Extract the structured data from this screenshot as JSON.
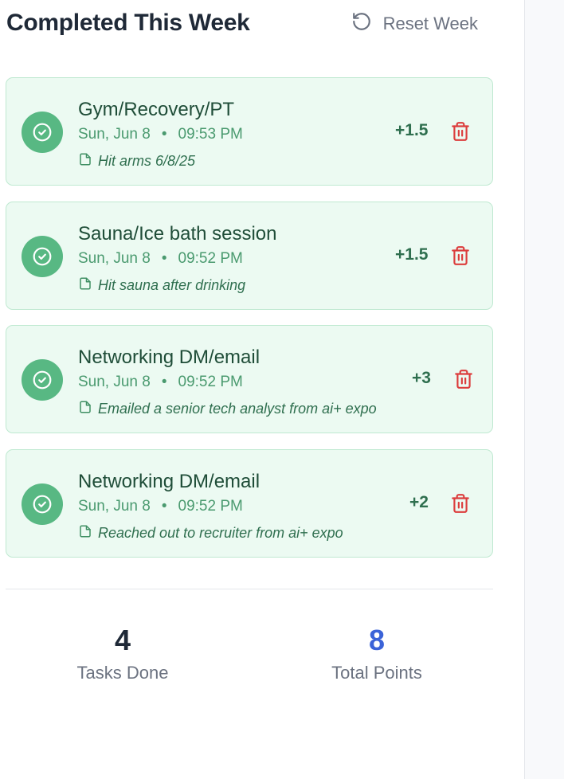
{
  "header": {
    "title": "Completed This Week",
    "reset_label": "Reset Week"
  },
  "tasks": [
    {
      "name": "Gym/Recovery/PT",
      "date": "Sun, Jun 8",
      "separator": "•",
      "time": "09:53 PM",
      "note": "Hit arms 6/8/25",
      "points": "+1.5"
    },
    {
      "name": "Sauna/Ice bath session",
      "date": "Sun, Jun 8",
      "separator": "•",
      "time": "09:52 PM",
      "note": "Hit sauna after drinking",
      "points": "+1.5"
    },
    {
      "name": "Networking DM/email",
      "date": "Sun, Jun 8",
      "separator": "•",
      "time": "09:52 PM",
      "note": "Emailed a senior tech analyst from ai+ expo",
      "points": "+3"
    },
    {
      "name": "Networking DM/email",
      "date": "Sun, Jun 8",
      "separator": "•",
      "time": "09:52 PM",
      "note": "Reached out to recruiter from ai+ expo",
      "points": "+2"
    }
  ],
  "stats": {
    "tasks_done_value": "4",
    "tasks_done_label": "Tasks Done",
    "total_points_value": "8",
    "total_points_label": "Total Points"
  },
  "colors": {
    "card_bg": "#ecfaf2",
    "card_border": "#bfe9d1",
    "check_circle": "#58b883",
    "task_name": "#1f4d38",
    "meta": "#4a9a6f",
    "trash": "#dc3c3c",
    "tasks_done_value": "#1f2937",
    "total_points_value": "#3b63d8"
  },
  "icons": {
    "reset": "rotate-ccw-icon",
    "check": "check-circle-icon",
    "note": "file-icon",
    "delete": "trash-icon"
  }
}
